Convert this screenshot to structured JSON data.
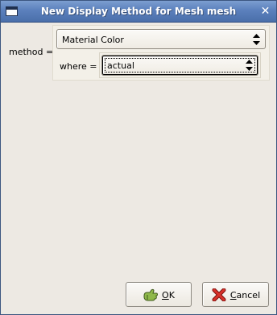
{
  "window": {
    "title": "New Display Method for Mesh mesh"
  },
  "form": {
    "method_label": "method =",
    "method_value": "Material Color",
    "where_label": "where =",
    "where_value": "actual"
  },
  "buttons": {
    "ok_mnemonic": "O",
    "ok_rest": "K",
    "cancel_mnemonic": "C",
    "cancel_rest": "ancel"
  },
  "icons": {
    "window_menu": "window-menu-icon",
    "close": "close-icon",
    "combo_arrows": "up-down-arrows-icon",
    "ok": "ok-hand-icon",
    "cancel": "cancel-x-icon"
  },
  "colors": {
    "titlebar": "#5b80bd",
    "window_bg": "#ede9e3",
    "cancel_icon": "#c4201c",
    "ok_icon": "#6f9a35"
  }
}
